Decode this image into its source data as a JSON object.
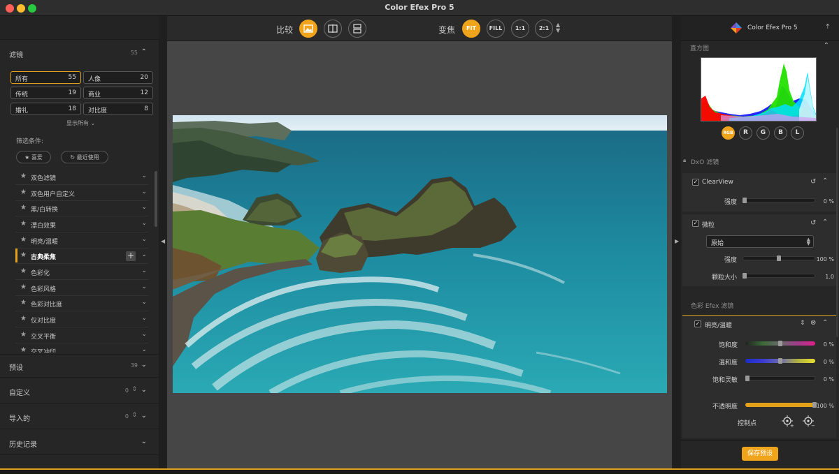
{
  "window": {
    "title": "Color Efex Pro 5"
  },
  "left": {
    "filters": {
      "label": "滤镜",
      "count": "55"
    },
    "categories": [
      {
        "name": "所有",
        "count": "55",
        "selected": true
      },
      {
        "name": "人像",
        "count": "20"
      },
      {
        "name": "传统",
        "count": "19"
      },
      {
        "name": "商业",
        "count": "12"
      },
      {
        "name": "婚礼",
        "count": "18"
      },
      {
        "name": "对比度",
        "count": "8"
      }
    ],
    "show_all": "显示所有",
    "filter_conditions": "筛选条件:",
    "favorites": "喜爱",
    "recent": "最近使用",
    "filter_list": [
      "双色滤镜",
      "双色用户自定义",
      "黑/白转换",
      "漂白效果",
      "明亮/温暖",
      "古典柔焦",
      "色彩化",
      "色彩风格",
      "色彩对比度",
      "仅对比度",
      "交叉平衡",
      "交叉冲印"
    ],
    "presets": {
      "label": "预设",
      "count": "39"
    },
    "custom": {
      "label": "自定义",
      "count": "0"
    },
    "imported": {
      "label": "导入的",
      "count": "0"
    },
    "history": {
      "label": "历史记录"
    }
  },
  "toolbar": {
    "compare_label": "比较",
    "zoom_label": "变焦",
    "zoom": {
      "fit": "FIT",
      "fill": "FILL",
      "one": "1:1",
      "two": "2:1"
    }
  },
  "right": {
    "app_name": "Color Efex Pro 5",
    "histogram_title": "直方图",
    "channels": [
      "RGB",
      "R",
      "G",
      "B",
      "L"
    ],
    "dxo_section": "DxO 滤镜",
    "clearview": {
      "title": "ClearView",
      "strength_label": "强度",
      "strength_value": "0 %"
    },
    "grain": {
      "title": "微粒",
      "preset": "原始",
      "strength_label": "强度",
      "strength_value": "100 %",
      "size_label": "颗粒大小",
      "size_value": "1.0"
    },
    "color_section": "色彩 Efex 滤镜",
    "brilliance": {
      "title": "明亮/温暖",
      "saturation_label": "饱和度",
      "saturation_value": "0 %",
      "warmth_label": "温和度",
      "warmth_value": "0 %",
      "sensitivity_label": "饱和灵敏",
      "sensitivity_value": "0 %",
      "opacity_label": "不透明度",
      "opacity_value": "100 %",
      "control_points_label": "控制点"
    },
    "save_preset": "保存预设"
  },
  "colors": {
    "accent": "#f0a41b"
  }
}
